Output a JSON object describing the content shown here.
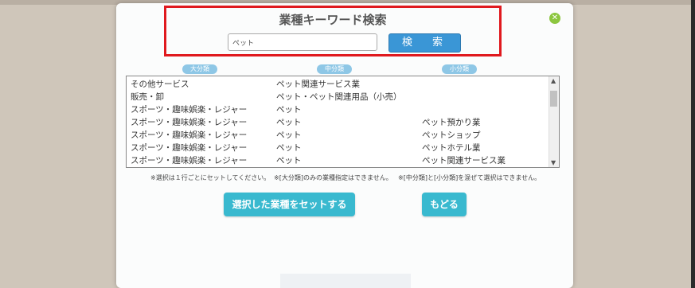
{
  "dialog": {
    "title": "業種キーワード検索",
    "search": {
      "value": "ペット",
      "button_label": "検　索"
    },
    "close_icon": "close-icon"
  },
  "columns": {
    "major": "大分類",
    "middle": "中分類",
    "minor": "小分類"
  },
  "results": [
    {
      "major": "その他サービス",
      "middle": "ペット関連サービス業",
      "minor": ""
    },
    {
      "major": "販売・卸",
      "middle": "ペット・ペット関連用品（小売）",
      "minor": ""
    },
    {
      "major": "スポーツ・趣味娯楽・レジャー",
      "middle": "ペット",
      "minor": ""
    },
    {
      "major": "スポーツ・趣味娯楽・レジャー",
      "middle": "ペット",
      "minor": "ペット預かり業"
    },
    {
      "major": "スポーツ・趣味娯楽・レジャー",
      "middle": "ペット",
      "minor": "ペットショップ"
    },
    {
      "major": "スポーツ・趣味娯楽・レジャー",
      "middle": "ペット",
      "minor": "ペットホテル業"
    },
    {
      "major": "スポーツ・趣味娯楽・レジャー",
      "middle": "ペット",
      "minor": "ペット関連サービス業"
    }
  ],
  "notes": {
    "note1": "※選択は１行ごとにセットしてください。",
    "note2": "※[大分類]のみの業種指定はできません。",
    "note3": "※[中分類]と[小分類]を混ぜて選択はできません。"
  },
  "buttons": {
    "set": "選択した業種をセットする",
    "back": "もどる"
  },
  "colors": {
    "accent": "#39b9cf",
    "search_button": "#3a96d6",
    "highlight": "#e0191e"
  }
}
